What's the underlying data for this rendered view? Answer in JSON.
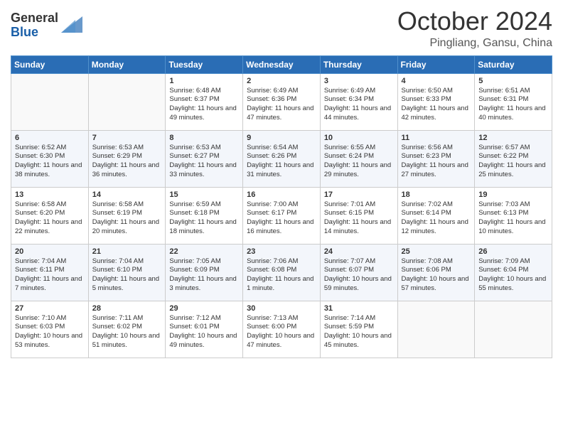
{
  "header": {
    "logo": {
      "line1": "General",
      "line2": "Blue"
    },
    "title": "October 2024",
    "location": "Pingliang, Gansu, China"
  },
  "weekdays": [
    "Sunday",
    "Monday",
    "Tuesday",
    "Wednesday",
    "Thursday",
    "Friday",
    "Saturday"
  ],
  "weeks": [
    [
      null,
      null,
      {
        "day": 1,
        "sunrise": "6:48 AM",
        "sunset": "6:37 PM",
        "daylight": "11 hours and 49 minutes."
      },
      {
        "day": 2,
        "sunrise": "6:49 AM",
        "sunset": "6:36 PM",
        "daylight": "11 hours and 47 minutes."
      },
      {
        "day": 3,
        "sunrise": "6:49 AM",
        "sunset": "6:34 PM",
        "daylight": "11 hours and 44 minutes."
      },
      {
        "day": 4,
        "sunrise": "6:50 AM",
        "sunset": "6:33 PM",
        "daylight": "11 hours and 42 minutes."
      },
      {
        "day": 5,
        "sunrise": "6:51 AM",
        "sunset": "6:31 PM",
        "daylight": "11 hours and 40 minutes."
      }
    ],
    [
      {
        "day": 6,
        "sunrise": "6:52 AM",
        "sunset": "6:30 PM",
        "daylight": "11 hours and 38 minutes."
      },
      {
        "day": 7,
        "sunrise": "6:53 AM",
        "sunset": "6:29 PM",
        "daylight": "11 hours and 36 minutes."
      },
      {
        "day": 8,
        "sunrise": "6:53 AM",
        "sunset": "6:27 PM",
        "daylight": "11 hours and 33 minutes."
      },
      {
        "day": 9,
        "sunrise": "6:54 AM",
        "sunset": "6:26 PM",
        "daylight": "11 hours and 31 minutes."
      },
      {
        "day": 10,
        "sunrise": "6:55 AM",
        "sunset": "6:24 PM",
        "daylight": "11 hours and 29 minutes."
      },
      {
        "day": 11,
        "sunrise": "6:56 AM",
        "sunset": "6:23 PM",
        "daylight": "11 hours and 27 minutes."
      },
      {
        "day": 12,
        "sunrise": "6:57 AM",
        "sunset": "6:22 PM",
        "daylight": "11 hours and 25 minutes."
      }
    ],
    [
      {
        "day": 13,
        "sunrise": "6:58 AM",
        "sunset": "6:20 PM",
        "daylight": "11 hours and 22 minutes."
      },
      {
        "day": 14,
        "sunrise": "6:58 AM",
        "sunset": "6:19 PM",
        "daylight": "11 hours and 20 minutes."
      },
      {
        "day": 15,
        "sunrise": "6:59 AM",
        "sunset": "6:18 PM",
        "daylight": "11 hours and 18 minutes."
      },
      {
        "day": 16,
        "sunrise": "7:00 AM",
        "sunset": "6:17 PM",
        "daylight": "11 hours and 16 minutes."
      },
      {
        "day": 17,
        "sunrise": "7:01 AM",
        "sunset": "6:15 PM",
        "daylight": "11 hours and 14 minutes."
      },
      {
        "day": 18,
        "sunrise": "7:02 AM",
        "sunset": "6:14 PM",
        "daylight": "11 hours and 12 minutes."
      },
      {
        "day": 19,
        "sunrise": "7:03 AM",
        "sunset": "6:13 PM",
        "daylight": "11 hours and 10 minutes."
      }
    ],
    [
      {
        "day": 20,
        "sunrise": "7:04 AM",
        "sunset": "6:11 PM",
        "daylight": "11 hours and 7 minutes."
      },
      {
        "day": 21,
        "sunrise": "7:04 AM",
        "sunset": "6:10 PM",
        "daylight": "11 hours and 5 minutes."
      },
      {
        "day": 22,
        "sunrise": "7:05 AM",
        "sunset": "6:09 PM",
        "daylight": "11 hours and 3 minutes."
      },
      {
        "day": 23,
        "sunrise": "7:06 AM",
        "sunset": "6:08 PM",
        "daylight": "11 hours and 1 minute."
      },
      {
        "day": 24,
        "sunrise": "7:07 AM",
        "sunset": "6:07 PM",
        "daylight": "10 hours and 59 minutes."
      },
      {
        "day": 25,
        "sunrise": "7:08 AM",
        "sunset": "6:06 PM",
        "daylight": "10 hours and 57 minutes."
      },
      {
        "day": 26,
        "sunrise": "7:09 AM",
        "sunset": "6:04 PM",
        "daylight": "10 hours and 55 minutes."
      }
    ],
    [
      {
        "day": 27,
        "sunrise": "7:10 AM",
        "sunset": "6:03 PM",
        "daylight": "10 hours and 53 minutes."
      },
      {
        "day": 28,
        "sunrise": "7:11 AM",
        "sunset": "6:02 PM",
        "daylight": "10 hours and 51 minutes."
      },
      {
        "day": 29,
        "sunrise": "7:12 AM",
        "sunset": "6:01 PM",
        "daylight": "10 hours and 49 minutes."
      },
      {
        "day": 30,
        "sunrise": "7:13 AM",
        "sunset": "6:00 PM",
        "daylight": "10 hours and 47 minutes."
      },
      {
        "day": 31,
        "sunrise": "7:14 AM",
        "sunset": "5:59 PM",
        "daylight": "10 hours and 45 minutes."
      },
      null,
      null
    ]
  ]
}
